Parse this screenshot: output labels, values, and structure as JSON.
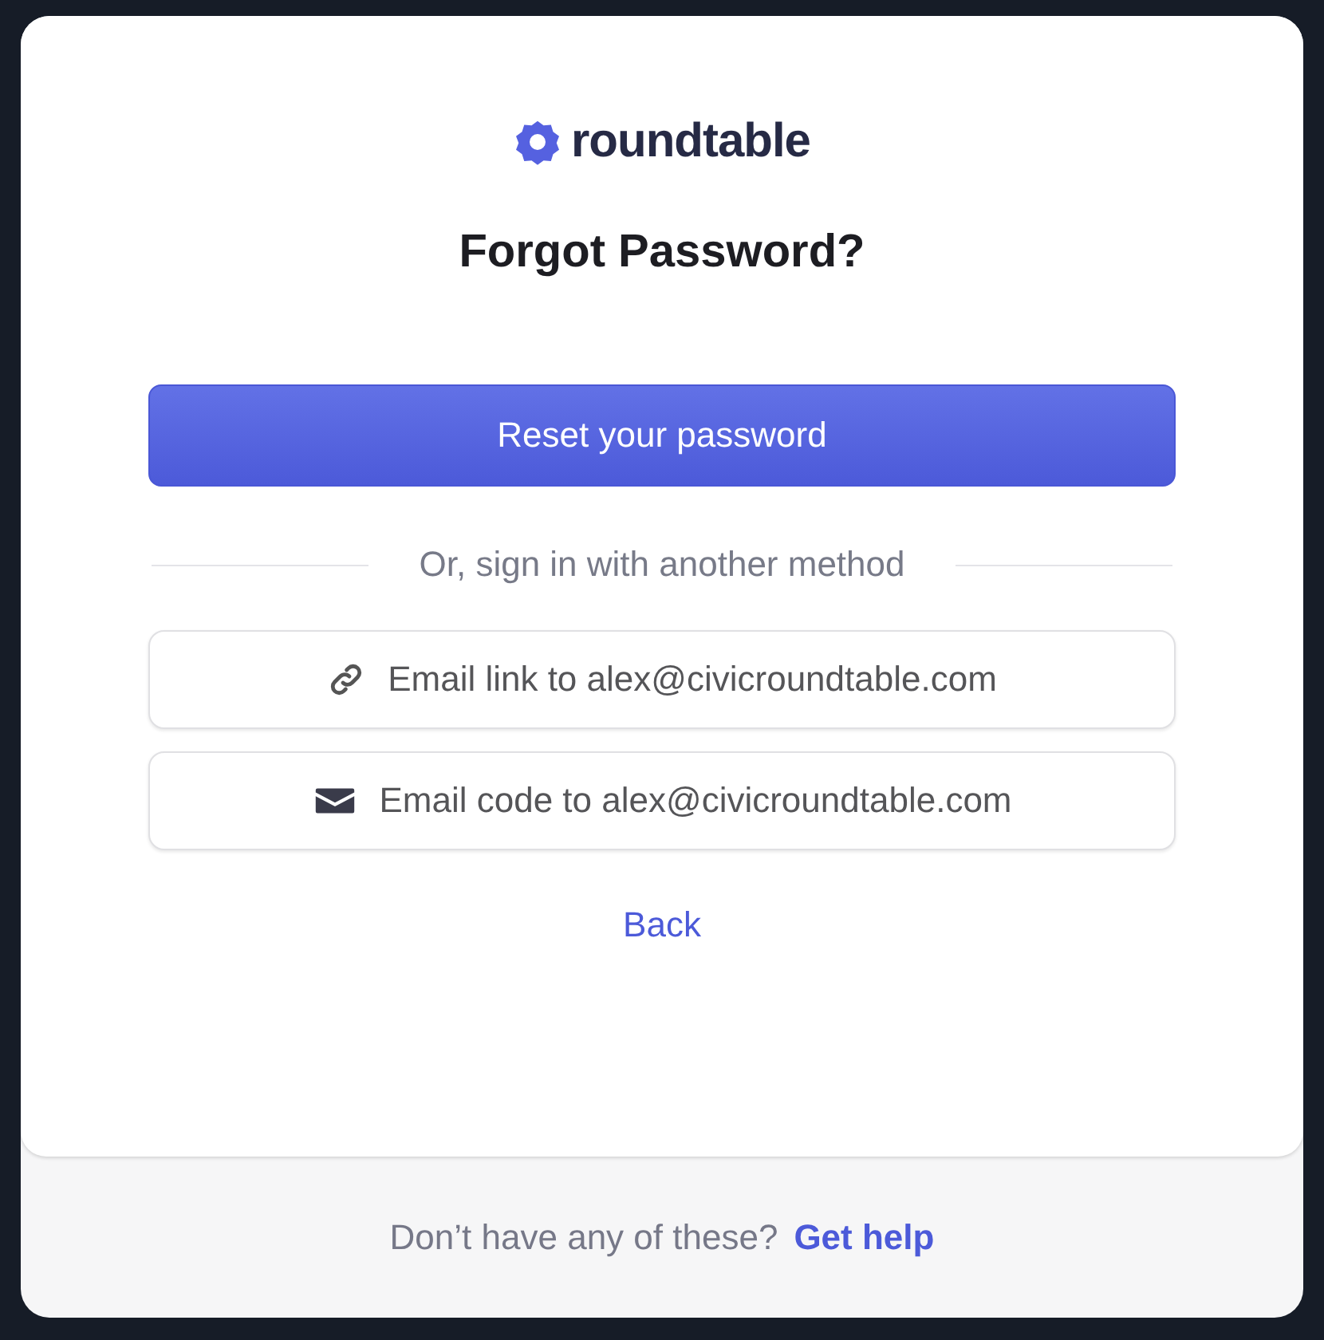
{
  "logo": {
    "text": "roundtable"
  },
  "title": "Forgot Password?",
  "primary_button": "Reset your password",
  "divider_text": "Or, sign in with another method",
  "methods": [
    {
      "kind": "link",
      "label": "Email link to alex@civicroundtable.com"
    },
    {
      "kind": "code",
      "label": "Email code to alex@civicroundtable.com"
    }
  ],
  "back_link": "Back",
  "footer": {
    "text": "Don’t have any of these?",
    "link": "Get help"
  }
}
